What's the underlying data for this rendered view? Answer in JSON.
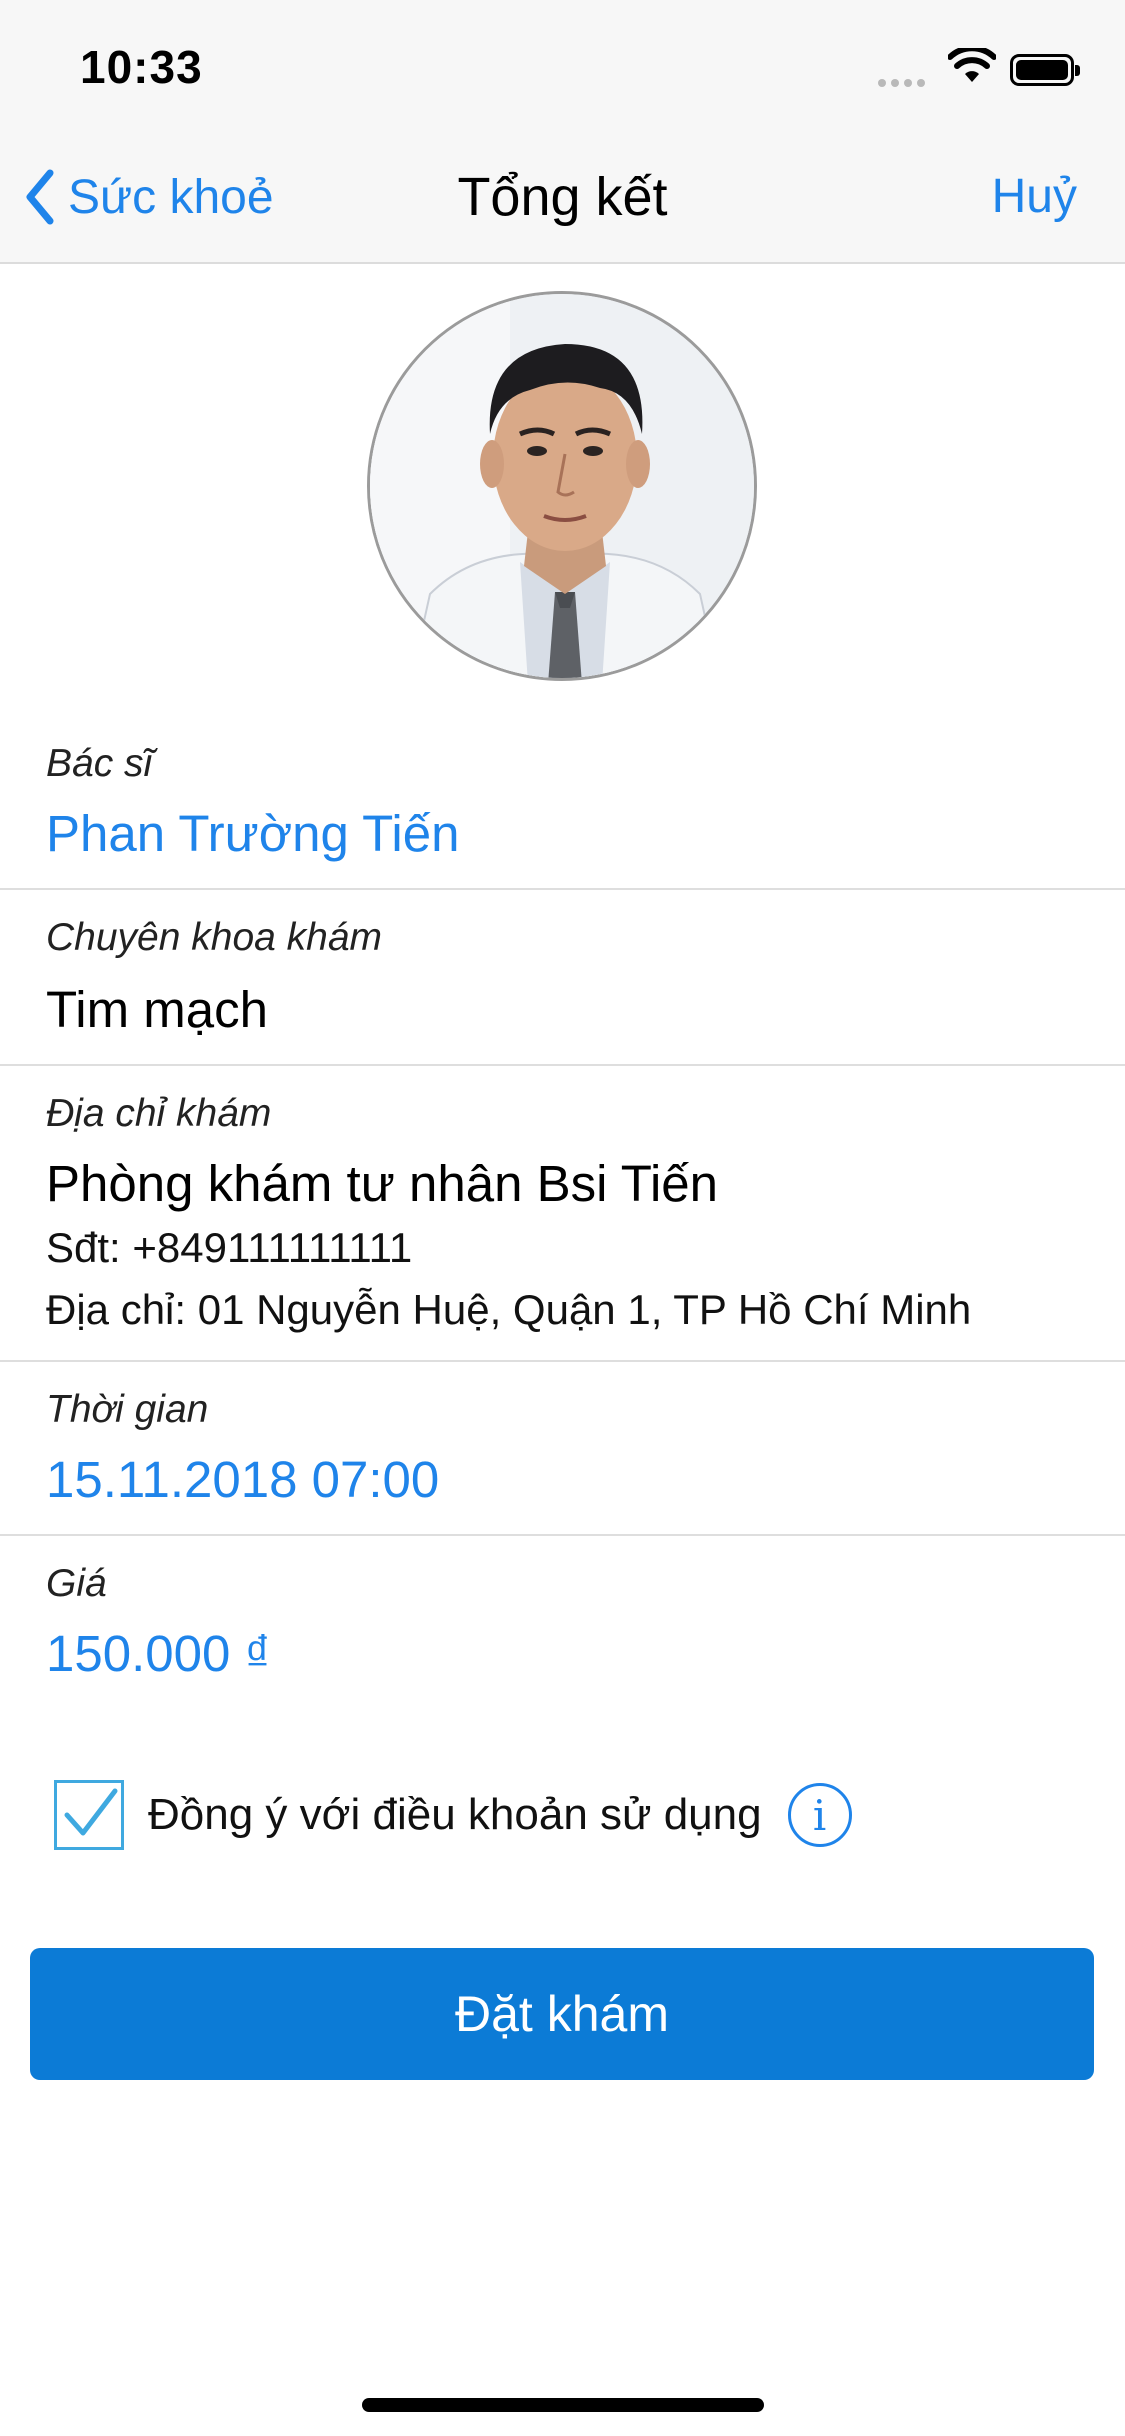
{
  "status_bar": {
    "time": "10:33"
  },
  "nav": {
    "back_label": "Sức khoẻ",
    "title": "Tổng kết",
    "cancel_label": "Huỷ"
  },
  "doctor": {
    "label": "Bác sĩ",
    "name": "Phan Trường Tiến"
  },
  "specialty": {
    "label": "Chuyên khoa khám",
    "value": "Tim mạch"
  },
  "address": {
    "label": "Địa chỉ khám",
    "clinic": "Phòng khám tư nhân Bsi Tiến",
    "phone": "Sđt: +849111111111",
    "street": "Địa chỉ: 01 Nguyễn Huệ, Quận 1, TP Hồ Chí Minh"
  },
  "time": {
    "label": "Thời gian",
    "value": "15.11.2018 07:00"
  },
  "price": {
    "label": "Giá",
    "value": "150.000 ₫"
  },
  "terms": {
    "checked": true,
    "label": "Đồng ý với điều khoản sử dụng"
  },
  "book_button": {
    "label": "Đặt khám"
  },
  "colors": {
    "accent": "#1f84ea",
    "button": "#0c7bd6",
    "checkbox": "#3fa9e0"
  }
}
